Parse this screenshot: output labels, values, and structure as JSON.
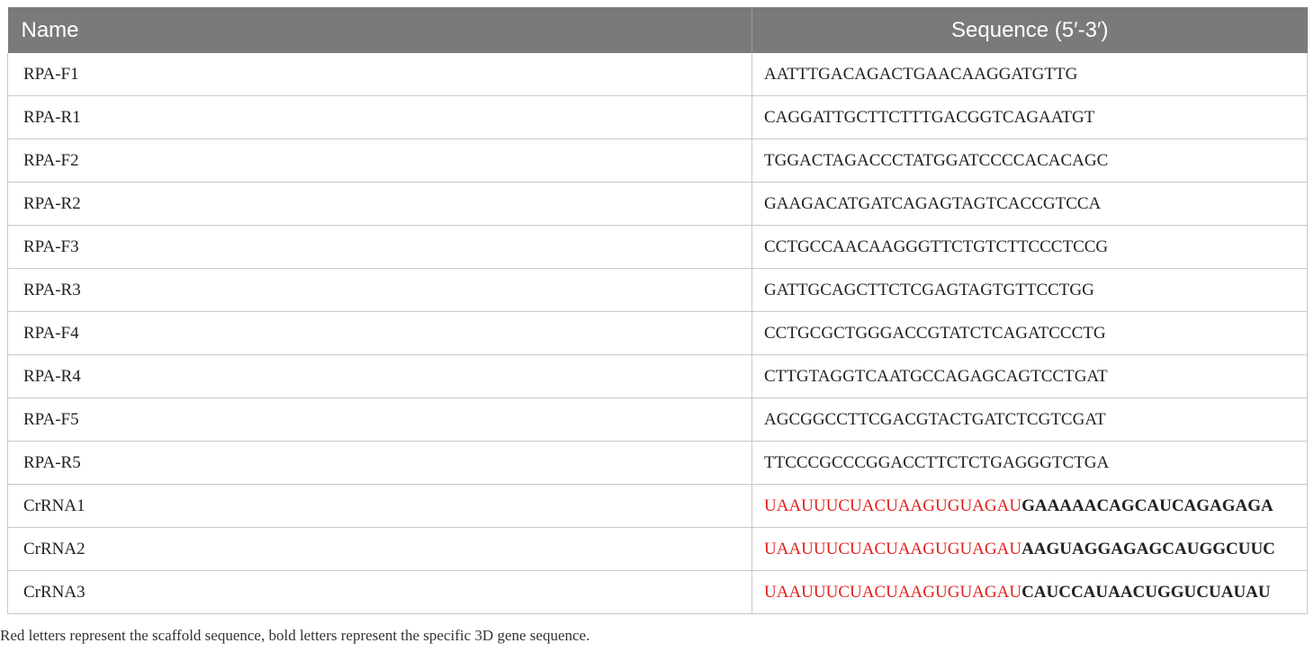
{
  "table": {
    "headers": {
      "name": "Name",
      "sequence": "Sequence (5′-3′)"
    },
    "rows": [
      {
        "name": "RPA-F1",
        "sequence": "AATTTGACAGACTGAACAAGGATGTTG"
      },
      {
        "name": "RPA-R1",
        "sequence": "CAGGATTGCTTCTTTGACGGTCAGAATGT"
      },
      {
        "name": "RPA-F2",
        "sequence": "TGGACTAGACCCTATGGATCCCCACACAGC"
      },
      {
        "name": "RPA-R2",
        "sequence": "GAAGACATGATCAGAGTAGTCACCGTCCA"
      },
      {
        "name": "RPA-F3",
        "sequence": "CCTGCCAACAAGGGTTCTGTCTTCCCTCCG"
      },
      {
        "name": "RPA-R3",
        "sequence": "GATTGCAGCTTCTCGAGTAGTGTTCCTGG"
      },
      {
        "name": "RPA-F4",
        "sequence": "CCTGCGCTGGGACCGTATCTCAGATCCCTG"
      },
      {
        "name": "RPA-R4",
        "sequence": "CTTGTAGGTCAATGCCAGAGCAGTCCTGAT"
      },
      {
        "name": "RPA-F5",
        "sequence": "AGCGGCCTTCGACGTACTGATCTCGTCGAT"
      },
      {
        "name": "RPA-R5",
        "sequence": "TTCCCGCCCGGACCTTCTCTGAGGGTCTGA"
      }
    ],
    "crna_rows": [
      {
        "name": "CrRNA1",
        "scaffold": "UAAUUUCUACUAAGUGUAGAU",
        "gene": "GAAAAACAGCAUCAGAGAGA"
      },
      {
        "name": "CrRNA2",
        "scaffold": "UAAUUUCUACUAAGUGUAGAU",
        "gene": "AAGUAGGAGAGCAUGGCUUC"
      },
      {
        "name": "CrRNA3",
        "scaffold": "UAAUUUCUACUAAGUGUAGAU",
        "gene": "CAUCCAUAACUGGUCUAUAU"
      }
    ]
  },
  "footnote": "Red letters represent the scaffold sequence, bold letters represent the specific 3D gene sequence.",
  "colors": {
    "header_bg": "#7a7a7a",
    "scaffold_red": "#e0201c",
    "border": "#c8c8c8"
  }
}
